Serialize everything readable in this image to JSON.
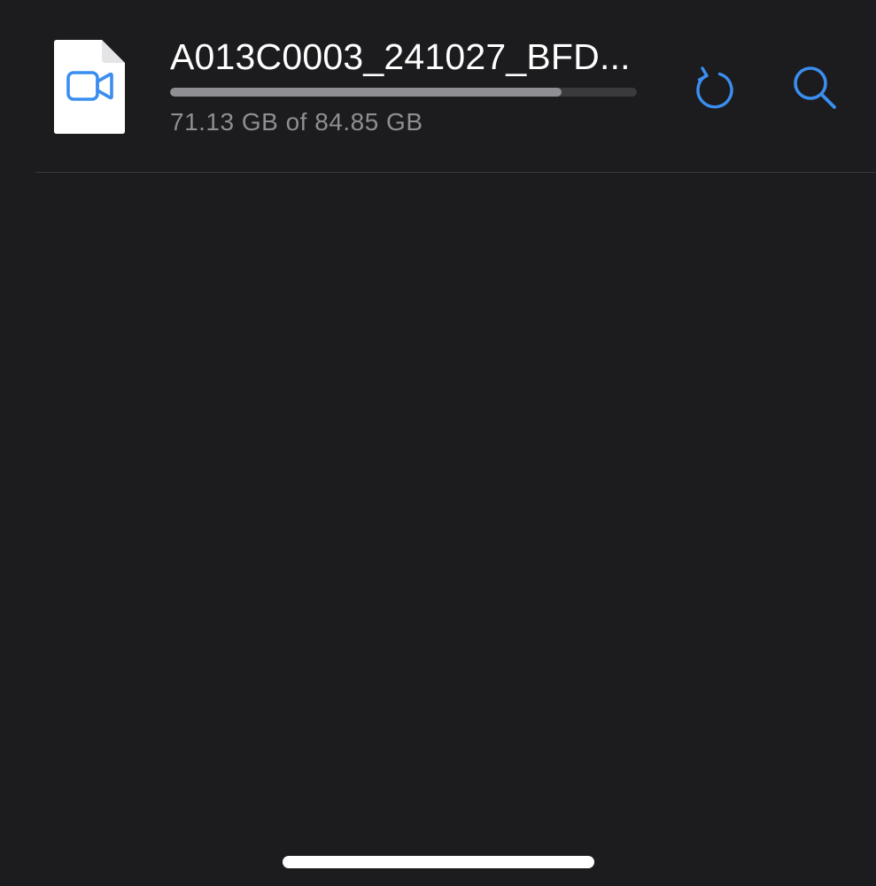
{
  "file": {
    "name": "A013C0003_241027_BFD...",
    "size_text": "71.13 GB of 84.85 GB",
    "progress_fraction": 0.8383,
    "thumbnail_icon": "video-camera-icon"
  },
  "actions": {
    "reload_icon": "reload-icon",
    "search_icon": "search-icon"
  },
  "colors": {
    "background": "#1c1c1e",
    "accent": "#3b8ef0",
    "progress_fill": "#8e8e93",
    "progress_track": "#3a3a3c",
    "secondary_text": "#8e8e93"
  }
}
